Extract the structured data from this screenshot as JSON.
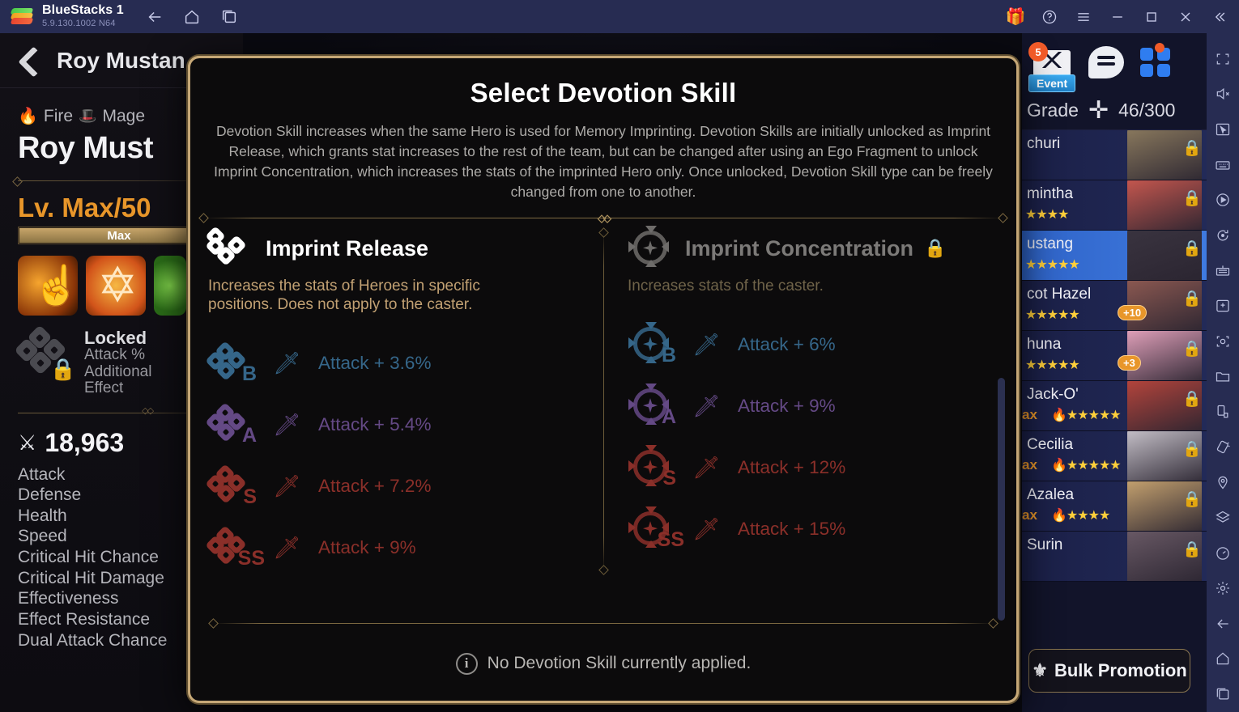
{
  "titlebar": {
    "app_name": "BlueStacks 1",
    "version": "5.9.130.1002  N64",
    "nav": [
      {
        "name": "back-icon",
        "label": "Back"
      },
      {
        "name": "home-icon",
        "label": "Home"
      },
      {
        "name": "recents-icon",
        "label": "Recent apps"
      }
    ],
    "right_controls": [
      {
        "name": "gift-icon",
        "label": "Gift"
      },
      {
        "name": "help-icon",
        "label": "Help"
      },
      {
        "name": "menu-icon",
        "label": "Menu"
      },
      {
        "name": "minimize-button",
        "label": "Minimize"
      },
      {
        "name": "maximize-button",
        "label": "Maximize"
      },
      {
        "name": "close-button",
        "label": "Close"
      },
      {
        "name": "collapse-icon",
        "label": "Collapse"
      }
    ]
  },
  "sidetools": [
    {
      "name": "fullscreen-icon",
      "label": "Fullscreen"
    },
    {
      "name": "mute-icon",
      "label": "Mute"
    },
    {
      "name": "cursor-icon",
      "label": "Cursor control"
    },
    {
      "name": "keyboard-icon",
      "label": "Game controls"
    },
    {
      "name": "macro-icon",
      "label": "Macro recorder"
    },
    {
      "name": "rotate-icon",
      "label": "Rotate"
    },
    {
      "name": "multi-instance-icon",
      "label": "Multi-instance"
    },
    {
      "name": "apk-install-icon",
      "label": "Install APK"
    },
    {
      "name": "screenshot-icon",
      "label": "Screenshot"
    },
    {
      "name": "media-folder-icon",
      "label": "Media manager"
    },
    {
      "name": "device-rotate-icon",
      "label": "Rotate device"
    },
    {
      "name": "shake-icon",
      "label": "Shake"
    },
    {
      "name": "location-icon",
      "label": "Location"
    },
    {
      "name": "layers-icon",
      "label": "Layers"
    },
    {
      "name": "performance-icon",
      "label": "Performance"
    },
    {
      "name": "settings-icon",
      "label": "Settings"
    },
    {
      "name": "android-back-icon",
      "label": "Back"
    },
    {
      "name": "android-home-icon",
      "label": "Home"
    },
    {
      "name": "android-recents-icon",
      "label": "Recents"
    }
  ],
  "hero_panel": {
    "back_label": "Back",
    "name_top": "Roy Mustan",
    "element": "Fire",
    "class": "Mage",
    "name_big": "Roy Must",
    "level": "Lv. Max/50",
    "level_bar_text": "Max",
    "devotion": {
      "status": "Locked",
      "line1": "Attack %",
      "line2": "Additional",
      "line3": "Effect"
    },
    "power": "18,963",
    "stats": [
      "Attack",
      "Defense",
      "Health",
      "Speed",
      "Critical Hit Chance",
      "Critical Hit Damage",
      "Effectiveness",
      "Effect Resistance",
      "Dual Attack Chance"
    ]
  },
  "hero_list": {
    "mail_badge": "5",
    "event_label": "Event",
    "grade_label": "Grade",
    "grade_value": "46/300",
    "items": [
      {
        "name": "churi",
        "selected": false,
        "locked": true,
        "stars": "",
        "max": "",
        "plus": "",
        "face": "#8b7a5e"
      },
      {
        "name": "mintha",
        "selected": false,
        "locked": true,
        "stars": "★★★★",
        "max": "",
        "plus": "",
        "face": "#c9584f"
      },
      {
        "name": "ustang",
        "selected": true,
        "locked": true,
        "stars": "★★★★★",
        "max": "",
        "plus": "",
        "face": "#3a3440"
      },
      {
        "name": "cot Hazel",
        "selected": false,
        "locked": true,
        "stars": "★★★★★",
        "max": "",
        "plus": "+10",
        "face": "#8e5a52"
      },
      {
        "name": "huna",
        "selected": false,
        "locked": true,
        "stars": "★★★★★",
        "max": "",
        "plus": "+3",
        "face": "#e5a3bd"
      },
      {
        "name": "Jack-O'",
        "selected": false,
        "locked": true,
        "stars": "★★★★★",
        "max": "ax",
        "plus": "",
        "face": "#b8453c"
      },
      {
        "name": "Cecilia",
        "selected": false,
        "locked": true,
        "stars": "★★★★★",
        "max": "ax",
        "plus": "",
        "face": "#c8c3cb"
      },
      {
        "name": "Azalea",
        "selected": false,
        "locked": true,
        "stars": "★★★★",
        "max": "ax",
        "plus": "",
        "face": "#c8a470"
      },
      {
        "name": "Surin",
        "selected": false,
        "locked": true,
        "stars": "",
        "max": "",
        "plus": "",
        "face": "#6a5a66"
      }
    ],
    "bulk_promotion_label": "Bulk Promotion"
  },
  "modal": {
    "title": "Select Devotion Skill",
    "description": "Devotion Skill increases when the same Hero is used for Memory Imprinting. Devotion Skills are initially unlocked as Imprint Release, which grants stat increases to the rest of the team, but can be changed after using an Ego Fragment to unlock Imprint Concentration, which increases the stats of the imprinted Hero only. Once unlocked, Devotion Skill type can be freely changed from one to another.",
    "columns": [
      {
        "title": "Imprint Release",
        "locked": false,
        "subtitle": "Increases the stats of Heroes in specific positions. Does not apply to the caster.",
        "icon": "diamond-cluster-icon",
        "rows": [
          {
            "rank": "B",
            "effect": "Attack + 3.6%",
            "color": "#4f9ed6"
          },
          {
            "rank": "A",
            "effect": "Attack + 5.4%",
            "color": "#9a6fd0"
          },
          {
            "rank": "S",
            "effect": "Attack + 7.2%",
            "color": "#d8453c"
          },
          {
            "rank": "SS",
            "effect": "Attack + 9%",
            "color": "#d8453c"
          }
        ]
      },
      {
        "title": "Imprint Concentration",
        "locked": true,
        "subtitle": "Increases stats of the caster.",
        "icon": "radial-burst-icon",
        "rows": [
          {
            "rank": "B",
            "effect": "Attack + 6%",
            "color": "#4f9ed6"
          },
          {
            "rank": "A",
            "effect": "Attack + 9%",
            "color": "#9a6fd0"
          },
          {
            "rank": "S",
            "effect": "Attack + 12%",
            "color": "#d8453c"
          },
          {
            "rank": "SS",
            "effect": "Attack + 15%",
            "color": "#d8453c"
          }
        ]
      }
    ],
    "footer_text": "No Devotion Skill currently applied."
  }
}
